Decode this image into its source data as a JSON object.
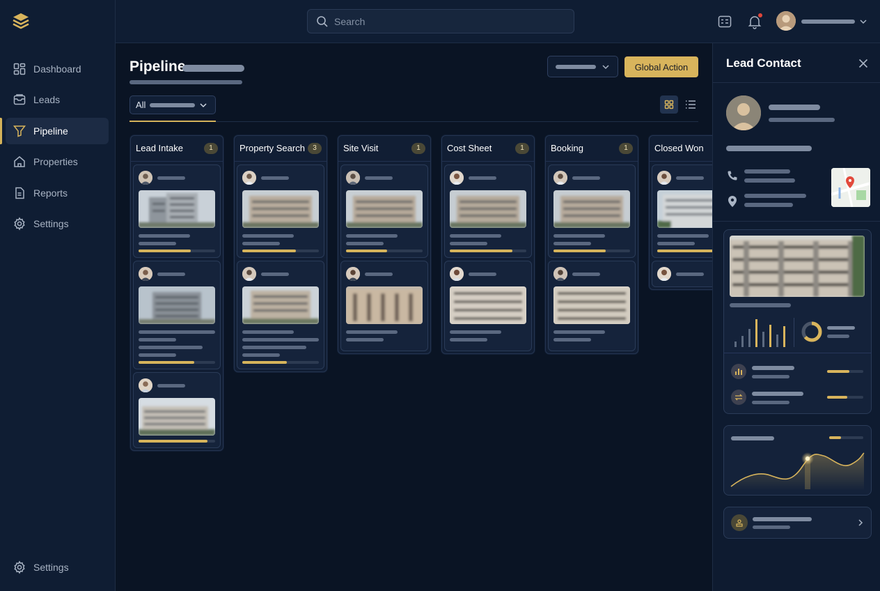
{
  "search": {
    "placeholder": "Search"
  },
  "nav": {
    "items": [
      {
        "label": "Dashboard",
        "icon": "grid-icon"
      },
      {
        "label": "Leads",
        "icon": "inbox-icon"
      },
      {
        "label": "Pipeline",
        "icon": "funnel-icon",
        "active": true
      },
      {
        "label": "Properties",
        "icon": "home-icon"
      },
      {
        "label": "Reports",
        "icon": "file-icon"
      },
      {
        "label": "Settings",
        "icon": "gear-icon"
      }
    ],
    "footer_settings": "Settings"
  },
  "main": {
    "title": "Pipeline",
    "filter_label": "All",
    "global_action": "Global Action"
  },
  "columns": [
    {
      "title": "Lead Intake",
      "count": "1"
    },
    {
      "title": "Property Search",
      "count": "3"
    },
    {
      "title": "Site Visit",
      "count": "1"
    },
    {
      "title": "Cost Sheet",
      "count": "1"
    },
    {
      "title": "Booking",
      "count": "1"
    },
    {
      "title": "Closed Won",
      "count": ""
    }
  ],
  "progress": {
    "lead_intake": [
      0.68,
      0.73,
      0.9
    ],
    "property_search": [
      0.7,
      0.58
    ],
    "site_visit": [
      0.54
    ],
    "cost_sheet": [
      0.82
    ],
    "booking": [
      0.68
    ],
    "closed_won": [
      0.8
    ]
  },
  "panel": {
    "title": "Lead Contact",
    "metric_fill": [
      0.62,
      0.55
    ],
    "chart_fill": 0.35
  },
  "colors": {
    "accent": "#d8b45c",
    "background": "#0b1628",
    "notification": "#e0463a"
  }
}
